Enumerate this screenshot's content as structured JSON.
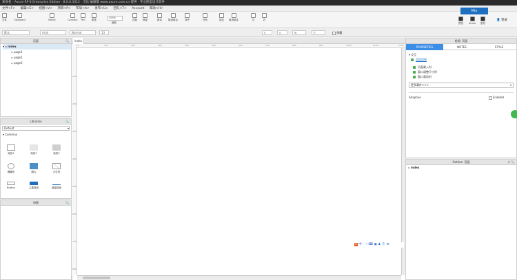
{
  "titlebar": {
    "text": "未命名 - Axure RP 8 Enterprise Edition · 8.0.0.3312 · 汉化·破解版 www.axure.com.cn 提供 · 专业原型设计软件"
  },
  "menu": [
    "文件<F>",
    "编辑<E>",
    "视图<V>",
    "项目<P>",
    "布局<A>",
    "发布<U>",
    "团队<T>",
    "Account",
    "帮助<H>"
  ],
  "toolbar": {
    "items": [
      {
        "label": "文件",
        "icon": "file-icon"
      },
      {
        "label": "Clipboard",
        "icon": "clipboard-icon"
      },
      {
        "label": "Select",
        "icon": "select-icon"
      },
      {
        "label": "Connect",
        "icon": "connect-icon"
      },
      {
        "label": "Pen",
        "icon": "pen-icon"
      },
      {
        "label": "更多",
        "icon": "more-icon"
      },
      {
        "label": "缩放",
        "icon": "zoom-icon"
      },
      {
        "label": "顶部",
        "icon": "top-icon"
      },
      {
        "label": "底部",
        "icon": "bottom-icon"
      },
      {
        "label": "组合",
        "icon": "group-icon"
      },
      {
        "label": "取消组合",
        "icon": "ungroup-icon"
      },
      {
        "label": "对齐",
        "icon": "align-icon"
      },
      {
        "label": "分布",
        "icon": "distribute-icon"
      },
      {
        "label": "锁定",
        "icon": "lock-icon"
      },
      {
        "label": "取消锁定",
        "icon": "unlock-icon"
      },
      {
        "label": "左",
        "icon": "left-icon"
      },
      {
        "label": "右",
        "icon": "right-icon"
      }
    ],
    "zoom": "100%",
    "right": [
      {
        "label": "预览",
        "icon": "preview-icon"
      },
      {
        "label": "Share",
        "icon": "share-icon"
      },
      {
        "label": "发布",
        "icon": "publish-icon"
      }
    ],
    "login": "登录",
    "banner": "Mix"
  },
  "formatbar": {
    "style": "默认",
    "font": "Arial",
    "weight": "Normal",
    "size": "13",
    "x": "x",
    "y": "y",
    "w": "w",
    "h": "h",
    "hidden": "隐藏"
  },
  "pages_panel": {
    "title": "页面",
    "root": "index",
    "children": [
      "page1",
      "page2",
      "page3"
    ]
  },
  "libraries_panel": {
    "title": "Libraries",
    "selected": "Default",
    "section": "Common",
    "items": [
      "矩形1",
      "矩形2",
      "矩形3",
      "椭圆形",
      "图片",
      "占位符",
      "Button",
      "主要按钮",
      "链接按钮"
    ]
  },
  "masters_panel": {
    "title": "母版"
  },
  "canvas": {
    "tab": "index",
    "ruler": [
      "0",
      "100",
      "200",
      "300",
      "400",
      "500",
      "600",
      "700",
      "800",
      "900",
      "1000",
      "1100",
      "1200"
    ],
    "vruler": [
      "100",
      "200",
      "300",
      "400",
      "500",
      "600",
      "700",
      "800"
    ]
  },
  "inspector": {
    "title": "检视: 页面",
    "tabs": [
      "PROPERTIES",
      "NOTES",
      "STYLE"
    ],
    "interactions_header": "交互",
    "add_case": "添加用例",
    "events": [
      "页面载入时",
      "窗口调整尺寸时",
      "窗口滚动时"
    ],
    "more_events": "更多事件>>>",
    "adaptive": "Adaptive",
    "enabled": "Enabled"
  },
  "outline_panel": {
    "title": "Outline: 页面",
    "item": "index"
  },
  "ime_bar": [
    "S",
    "中",
    "·",
    "☽",
    "⌨",
    "▣",
    "♟",
    "👕",
    "⚙"
  ]
}
